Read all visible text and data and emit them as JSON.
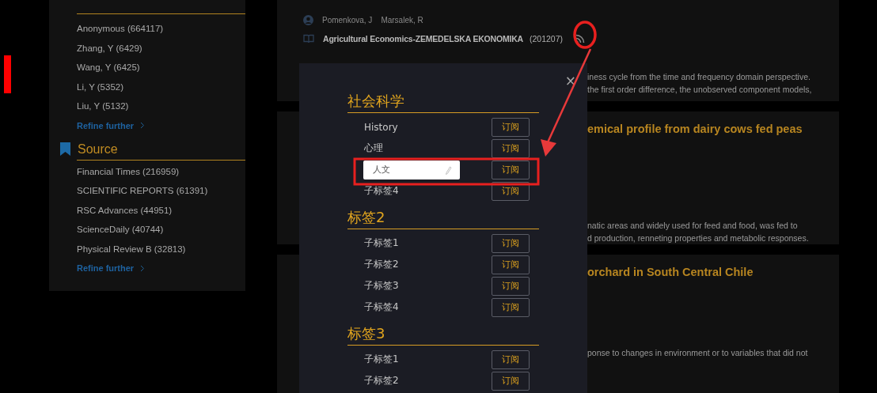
{
  "sidebar": {
    "author_items": [
      "Anonymous (664117)",
      "Zhang, Y (6429)",
      "Wang, Y (6425)",
      "Li, Y (5352)",
      "Liu, Y (5132)"
    ],
    "author_refine": "Refine further",
    "source_title": "Source",
    "source_items": [
      "Financial Times (216959)",
      "SCIENTIFIC REPORTS (61391)",
      "RSC Advances (44951)",
      "ScienceDaily (40744)",
      "Physical Review B (32813)"
    ],
    "source_refine": "Refine further"
  },
  "results": [
    {
      "authors": [
        "Pomenkova, J",
        "Marsalek, R"
      ],
      "journal": "Agricultural Economics-ZEMEDELSKA EKONOMIKA",
      "date": "(201207)",
      "abstract": [
        "iness cycle from the time and frequency domain perspective.",
        "the first order difference, the unobserved component models,"
      ]
    },
    {
      "title": "emical profile from dairy cows fed peas",
      "abstract": [
        "natic areas and widely used for feed and food, was fed to",
        "d production, renneting properties and metabolic responses."
      ]
    },
    {
      "title": "orchard in South Central Chile",
      "abstract": [
        "ponse to changes in environment or to variables that did not"
      ]
    }
  ],
  "modal": {
    "close": "×",
    "sections": [
      {
        "title": "社会科学",
        "items": [
          {
            "kind": "label",
            "text": "History",
            "button": "订阅"
          },
          {
            "kind": "label",
            "text": "心理",
            "button": "订阅"
          },
          {
            "kind": "input",
            "value": "人文",
            "button": "订阅"
          },
          {
            "kind": "label",
            "text": "子标签4",
            "button": "订阅"
          }
        ]
      },
      {
        "title": "标签2",
        "items": [
          {
            "kind": "label",
            "text": "子标签1",
            "button": "订阅"
          },
          {
            "kind": "label",
            "text": "子标签2",
            "button": "订阅"
          },
          {
            "kind": "label",
            "text": "子标签3",
            "button": "订阅"
          },
          {
            "kind": "label",
            "text": "子标签4",
            "button": "订阅"
          }
        ]
      },
      {
        "title": "标签3",
        "items": [
          {
            "kind": "label",
            "text": "子标签1",
            "button": "订阅"
          },
          {
            "kind": "label",
            "text": "子标签2",
            "button": "订阅"
          }
        ]
      }
    ]
  }
}
